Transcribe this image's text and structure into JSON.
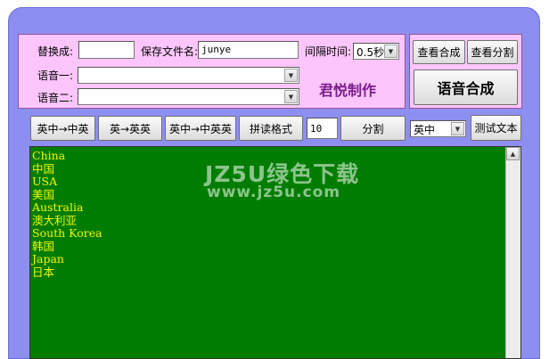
{
  "top_panel": {
    "replace_label": "替换成:",
    "replace_value": "",
    "save_label": "保存文件名:",
    "save_value": "junye",
    "interval_label": "间隔时间:",
    "interval_value": "0.5秒",
    "voice1_label": "语音一:",
    "voice1_value": "",
    "voice2_label": "语音二:",
    "voice2_value": "",
    "credit": "君悦制作"
  },
  "right_panel": {
    "view_synthesis": "查看合成",
    "view_split": "查看分割",
    "synthesize": "语音合成"
  },
  "toolbar": {
    "btn1": "英中→中英",
    "btn2": "英→英英",
    "btn3": "英中→中英英",
    "btn4": "拼读格式",
    "count_value": "10",
    "split": "分割",
    "lang_value": "英中",
    "test_text": "测试文本"
  },
  "text_lines": [
    "China",
    "中国",
    "USA",
    "美国",
    "Australia",
    "澳大利亚",
    "South Korea",
    "韩国",
    "Japan",
    "日本"
  ],
  "watermark": {
    "line1": "JZ5U绿色下载",
    "line2": "www.jz5u.com"
  },
  "colors": {
    "frame": "#8d8ff0",
    "panel": "#fcc6fc",
    "text_bg": "#007d00",
    "text_fg": "#f4f40a"
  }
}
